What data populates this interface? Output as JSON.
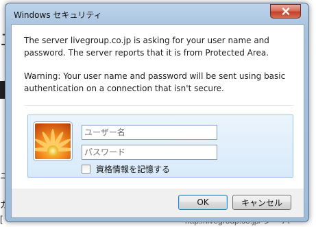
{
  "background": {
    "fragment_1": "エ",
    "fragment_2": "ニ",
    "fragment_3": "ガ",
    "fragment_4": "[",
    "status_url": "http://livegroup.co.jp/ シ ーパ"
  },
  "dialog": {
    "title": "Windows セキュリティ",
    "message": "The server livegroup.co.jp is asking for your user name and password. The server reports that it is from Protected Area.",
    "warning": "Warning: Your user name and password will be sent using basic authentication on a connection that isn't secure.",
    "username_placeholder": "ユーザー名",
    "password_placeholder": "パスワード",
    "remember_label": "資格情報を記憶する",
    "remember_checked": false,
    "ok_label": "OK",
    "cancel_label": "キャンセル",
    "close_icon": "close-icon",
    "avatar_icon": "user-avatar-icon"
  },
  "colors": {
    "titlebar": "#a9c3df",
    "close_button": "#c2412a",
    "credential_panel": "#d8eaf9",
    "ok_button_border": "#3c7fb1"
  }
}
